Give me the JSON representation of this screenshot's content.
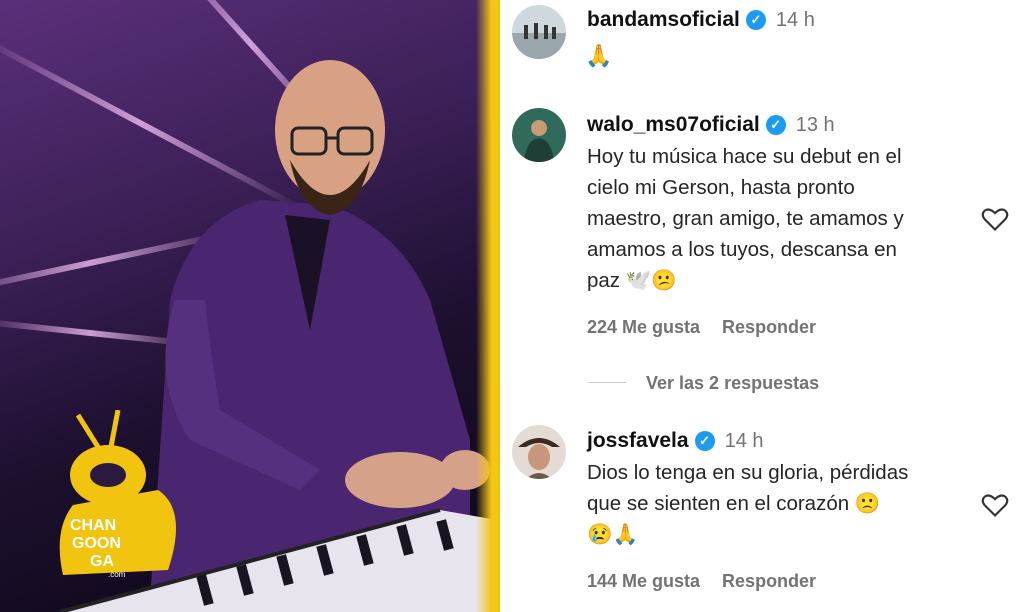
{
  "watermark": {
    "text": "CHANGOONGA",
    "domain": ".com"
  },
  "comments": [
    {
      "username": "bandamsoficial",
      "verified": true,
      "time": "14 h",
      "text": "🙏",
      "likes": "",
      "reply": ""
    },
    {
      "username": "walo_ms07oficial",
      "verified": true,
      "time": "13 h",
      "text_lines": [
        "Hoy tu música hace su debut en el",
        "cielo mi Gerson, hasta pronto",
        "maestro, gran amigo, te amamos y",
        "amamos a los tuyos, descansa en",
        "paz 🕊️😕"
      ],
      "likes": "224 Me gusta",
      "reply": "Responder"
    },
    {
      "username": "jossfavela",
      "verified": true,
      "time": "14 h",
      "text_lines": [
        "Dios lo tenga en su gloria, pérdidas",
        "que se sienten en el corazón 🙁",
        "😢🙏"
      ],
      "likes": "144 Me gusta",
      "reply": "Responder"
    }
  ],
  "view_replies": "Ver las 2 respuestas",
  "colors": {
    "accent_yellow": "#f1c40f",
    "verified_blue": "#1d9bf0",
    "muted": "#737373"
  },
  "icons": [
    "heart-icon",
    "verified-badge-icon",
    "hands-pray-emoji"
  ]
}
